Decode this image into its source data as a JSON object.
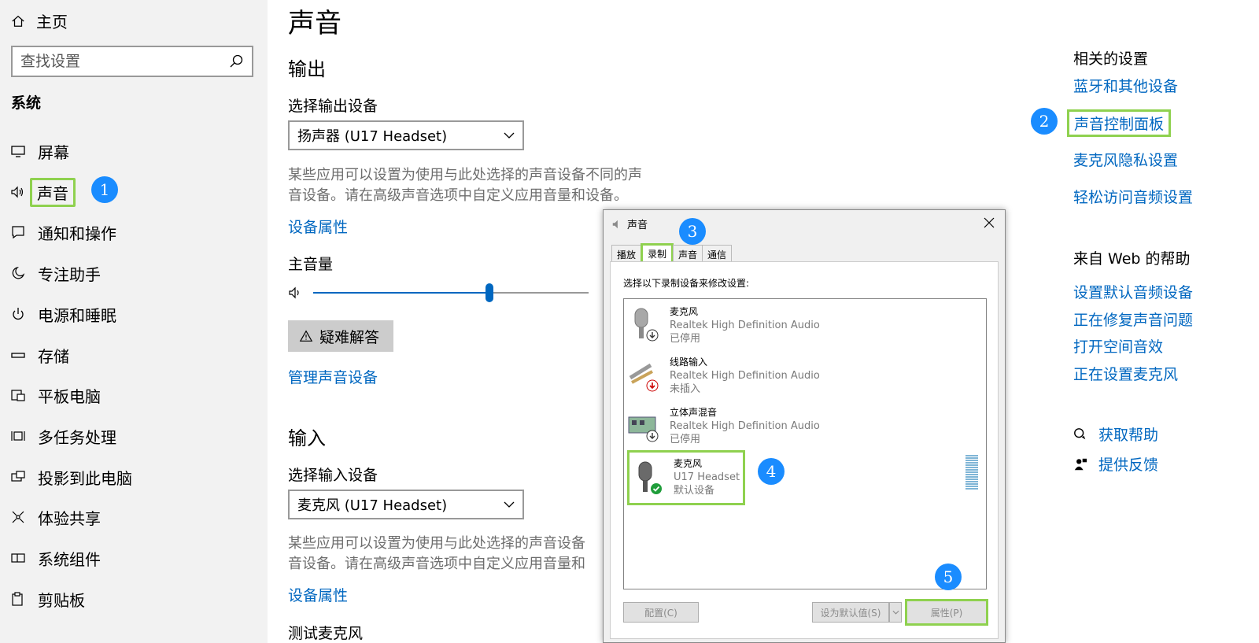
{
  "sidebar": {
    "home_label": "主页",
    "search_placeholder": "查找设置",
    "section_title": "系统",
    "items": [
      {
        "label": "屏幕",
        "icon": "monitor-icon"
      },
      {
        "label": "声音",
        "icon": "speaker-icon"
      },
      {
        "label": "通知和操作",
        "icon": "notification-icon"
      },
      {
        "label": "专注助手",
        "icon": "moon-icon"
      },
      {
        "label": "电源和睡眠",
        "icon": "power-icon"
      },
      {
        "label": "存储",
        "icon": "storage-icon"
      },
      {
        "label": "平板电脑",
        "icon": "tablet-icon"
      },
      {
        "label": "多任务处理",
        "icon": "multitask-icon"
      },
      {
        "label": "投影到此电脑",
        "icon": "project-icon"
      },
      {
        "label": "体验共享",
        "icon": "share-icon"
      },
      {
        "label": "系统组件",
        "icon": "components-icon"
      },
      {
        "label": "剪贴板",
        "icon": "clipboard-icon"
      }
    ]
  },
  "badges": {
    "b1": "1",
    "b2": "2",
    "b3": "3",
    "b4": "4",
    "b5": "5"
  },
  "main": {
    "title": "声音",
    "output": {
      "heading": "输出",
      "select_label": "选择输出设备",
      "selected_device": "扬声器 (U17 Headset)",
      "desc_line1": "某些应用可以设置为使用与此处选择的声音设备不同的声",
      "desc_line2": "音设备。请在高级声音选项中自定义应用音量和设备。",
      "device_props_link": "设备属性",
      "volume_label": "主音量",
      "volume_level": 0.64,
      "troubleshoot_label": "疑难解答",
      "manage_link": "管理声音设备"
    },
    "input": {
      "heading": "输入",
      "select_label": "选择输入设备",
      "selected_device": "麦克风 (U17 Headset)",
      "desc_line1": "某些应用可以设置为使用与此处选择的声音设备",
      "desc_line2": "音设备。请在高级声音选项中自定义应用音量和",
      "device_props_link": "设备属性",
      "test_label": "测试麦克风"
    }
  },
  "related": {
    "heading": "相关的设置",
    "links": [
      "蓝牙和其他设备",
      "声音控制面板",
      "麦克风隐私设置",
      "轻松访问音频设置"
    ],
    "web_heading": "来自 Web 的帮助",
    "web_links": [
      "设置默认音频设备",
      "正在修复声音问题",
      "打开空间音效",
      "正在设置麦克风"
    ],
    "get_help": "获取帮助",
    "feedback": "提供反馈"
  },
  "dialog": {
    "title": "声音",
    "tabs": [
      "播放",
      "录制",
      "声音",
      "通信"
    ],
    "hint": "选择以下录制设备来修改设置:",
    "devices": [
      {
        "name": "麦克风",
        "driver": "Realtek High Definition Audio",
        "status": "已停用"
      },
      {
        "name": "线路输入",
        "driver": "Realtek High Definition Audio",
        "status": "未插入"
      },
      {
        "name": "立体声混音",
        "driver": "Realtek High Definition Audio",
        "status": "已停用"
      },
      {
        "name": "麦克风",
        "driver": "U17 Headset",
        "status": "默认设备"
      }
    ],
    "btn_configure": "配置(C)",
    "btn_set_default": "设为默认值(S)",
    "btn_properties": "属性(P)"
  },
  "colors": {
    "accent": "#0067c0",
    "highlight": "#8fd14f",
    "badge": "#1a8cff"
  }
}
